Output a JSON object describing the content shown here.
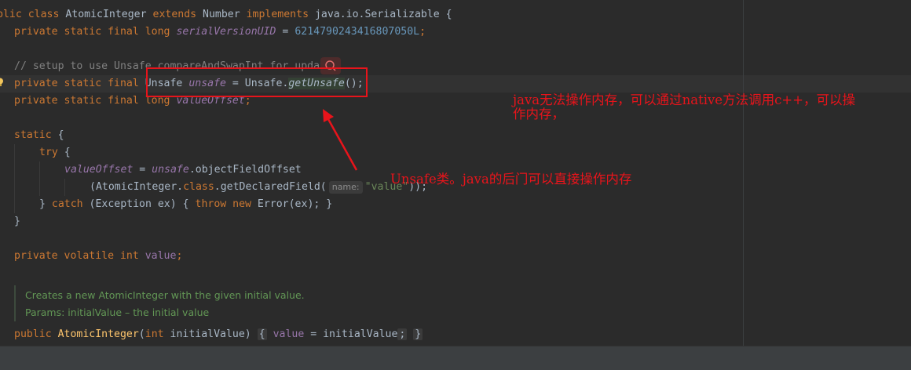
{
  "code": {
    "l1": {
      "kw1": "blic class ",
      "name": "AtomicInteger ",
      "kw2": "extends ",
      "sup": "Number ",
      "kw3": "implements ",
      "iface": "java.io.Serializable {"
    },
    "l2": {
      "kw": "private static final long ",
      "field": "serialVersionUID",
      "eq": " = ",
      "num": "6214790243416807050L",
      "end": ";"
    },
    "l4": {
      "comment": "// setup to use Unsafe.compareAndSwapInt for updates"
    },
    "l5": {
      "kw": "private static final ",
      "type": "Unsafe ",
      "field": "unsafe",
      "eq": " = Unsafe.",
      "method": "getUnsafe",
      "end": "();"
    },
    "l6": {
      "kw": "private static final long ",
      "field": "valueOffset",
      "end": ";"
    },
    "l8": {
      "kw": "static",
      "rest": " {"
    },
    "l9": {
      "kw": "try",
      "rest": " {"
    },
    "l10": {
      "field": "valueOffset",
      "eq": " = ",
      "field2": "unsafe",
      "rest": ".objectFieldOffset"
    },
    "l11": {
      "pre": "(AtomicInteger.",
      "kw": "class",
      "mid": ".getDeclaredField(",
      "hint": "name:",
      "str": "\"value\"",
      "end": "));"
    },
    "l12": {
      "a": "} ",
      "kw1": "catch",
      " b": " (Exception ex) { ",
      "kw2": "throw ",
      "kw3": "new ",
      "c": "Error(ex); }"
    },
    "l13": {
      "text": "}"
    },
    "l15": {
      "kw": "private volatile int ",
      "field": "value",
      "end": ";"
    },
    "doc1": "Creates a new AtomicInteger with the given initial value.",
    "doc2": "Params: initialValue – the initial value",
    "l19": {
      "kw": "public ",
      "name": "AtomicInteger",
      "open": "(",
      "kw2": "int ",
      "param": "initialValue)",
      "b1": "{",
      "field": "value",
      "eq": " = initialValue",
      "semi": ";",
      "b2": "}"
    }
  },
  "annotations": {
    "note1_line1": "java无法操作内存，可以通过native方法调用c++，可以操",
    "note1_line2": "作内存，",
    "note2": "Unsafe类。java的后门可以直接操作内存"
  },
  "colors": {
    "annotation": "#e8141b",
    "keyword": "#cc7832",
    "field": "#9876aa",
    "number": "#6897bb",
    "string": "#6a8759",
    "comment": "#808080",
    "doc": "#629755"
  }
}
